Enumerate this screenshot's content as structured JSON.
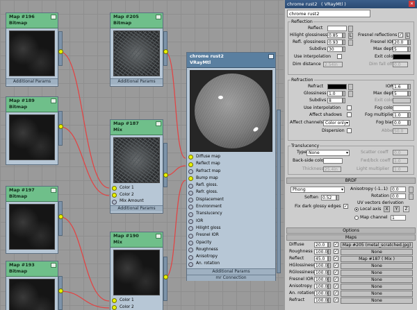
{
  "nodes": {
    "map196": {
      "title": "Map #196",
      "type": "Bitmap",
      "params": "Additional Params"
    },
    "map189": {
      "title": "Map #189",
      "type": "Bitmap"
    },
    "map197": {
      "title": "Map #197",
      "type": "Bitmap"
    },
    "map193": {
      "title": "Map #193",
      "type": "Bitmap"
    },
    "map205": {
      "title": "Map #205",
      "type": "Bitmap",
      "params": "Additional Params"
    },
    "map187": {
      "title": "Map #187",
      "type": "Mix",
      "slots": [
        "Color 1",
        "Color 2",
        "Mix Amount"
      ],
      "params": "Additional Params"
    },
    "map190": {
      "title": "Map #190",
      "type": "Mix",
      "slots": [
        "Color 1",
        "Color 2"
      ]
    },
    "vray": {
      "title": "chrome rust2",
      "type": "VRayMtl",
      "slots": [
        "Diffuse map",
        "Reflect map",
        "Refract map",
        "Bump map",
        "Refl. gloss.",
        "Refr. gloss.",
        "Displacement",
        "Environment",
        "Translucency",
        "IOR",
        "Hilight gloss",
        "Fresnel IOR",
        "Opacity",
        "Roughness",
        "Anisotropy",
        "An. rotation"
      ],
      "footer1": "Additional Params",
      "footer2": "mr Connection"
    }
  },
  "panel": {
    "window_title": "chrome rust2",
    "window_subtitle": "( VRayMtl )",
    "material_name": "chrome rust2",
    "reflection": {
      "title": "Reflection",
      "reflect": "Reflect",
      "hilight_glossiness": "Hilight glossiness",
      "hilight_glossiness_value": "0.85",
      "refl_glossiness": "Refl. glossiness",
      "refl_glossiness_value": "0.93",
      "subdivs": "Subdivs",
      "subdivs_value": "30",
      "use_interpolation": "Use interpolation",
      "dim_distance": "Dim distance",
      "dim_distance_value": "2.54in",
      "fresnel_reflections": "Fresnel reflections",
      "fresnel_ior": "Fresnel IOR",
      "fresnel_ior_value": "20.0",
      "max_depth": "Max depth",
      "max_depth_value": "5",
      "exit_color": "Exit color",
      "dim_fall_off": "Dim fall off",
      "dim_fall_off_value": "0.0",
      "lock": "L"
    },
    "refraction": {
      "title": "Refraction",
      "refract": "Refract",
      "glossiness": "Glossiness",
      "glossiness_value": "1.0",
      "subdivs": "Subdivs",
      "subdivs_value": "8",
      "use_interpolation": "Use interpolation",
      "affect_shadows": "Affect shadows",
      "affect_channels": "Affect channels",
      "affect_channels_value": "Color only",
      "dispersion": "Dispersion",
      "ior": "IOR",
      "ior_value": "1.6",
      "max_depth": "Max depth",
      "max_depth_value": "5",
      "exit_color": "Exit color",
      "fog_color": "Fog color",
      "fog_multiplier": "Fog multiplier",
      "fog_multiplier_value": "1.0",
      "fog_bias": "Fog bias",
      "fog_bias_value": "0.0",
      "abbe": "Abbe",
      "abbe_value": "50.0"
    },
    "translucency": {
      "title": "Translucency",
      "type": "Type",
      "type_value": "None",
      "backside_color": "Back-side color",
      "thickness": "Thickness",
      "thickness_value": "25.4in",
      "scatter_coeff": "Scatter coeff",
      "scatter_coeff_value": "0.0",
      "fwd_bck_coeff": "Fwd/bck coeff",
      "fwd_bck_coeff_value": "1.0",
      "light_multiplier": "Light multiplier",
      "light_multiplier_value": "1.0"
    },
    "brdf": {
      "title": "BRDF",
      "type_value": "Phong",
      "soften": "Soften",
      "soften_value": "0.52",
      "fix_dark": "Fix dark glossy edges",
      "anisotropy": "Anisotropy (-1..1)",
      "anisotropy_value": "0.0",
      "rotation": "Rotation",
      "rotation_value": "0.0",
      "uv_title": "UV vectors derivation",
      "local_axis": "Local axis",
      "axis_x": "X",
      "axis_y": "Y",
      "axis_z": "Z",
      "map_channel": "Map channel",
      "map_channel_value": "1"
    },
    "options_title": "Options",
    "maps_title": "Maps",
    "maps": [
      {
        "label": "Diffuse",
        "amount": "20.0",
        "map": "Map #205 (metal_scratched.jpg)"
      },
      {
        "label": "Roughness",
        "amount": "100.0",
        "map": "None"
      },
      {
        "label": "Reflect",
        "amount": "45.0",
        "map": "Map #187  ( Mix )"
      },
      {
        "label": "HGlossiness",
        "amount": "100.0",
        "map": "None"
      },
      {
        "label": "RGlossiness",
        "amount": "100.0",
        "map": "None"
      },
      {
        "label": "Fresnel IOR",
        "amount": "100.0",
        "map": "None"
      },
      {
        "label": "Anisotropy",
        "amount": "100.0",
        "map": "None"
      },
      {
        "label": "An. rotation",
        "amount": "100.0",
        "map": "None"
      },
      {
        "label": "Refract",
        "amount": "100.0",
        "map": "None"
      }
    ]
  },
  "colors": {
    "node_header": "#6fbf8a",
    "vray_header": "#5a7fa0",
    "wire": "#e04545",
    "slot_active": "#e8f200",
    "title_bar": "#2a4a72"
  }
}
